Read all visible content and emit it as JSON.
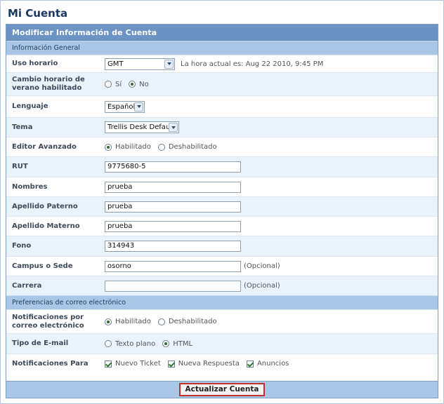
{
  "page": {
    "title": "Mi Cuenta"
  },
  "panel": {
    "title": "Modificar Información de Cuenta"
  },
  "sections": {
    "general": "Información General",
    "email": "Preferencias de correo electrónico"
  },
  "fields": {
    "timezone": {
      "label": "Uso horario",
      "value": "GMT",
      "hint": "La hora actual es: Aug 22 2010, 9:45 PM"
    },
    "dst": {
      "label": "Cambio horario de verano habilitado",
      "yes": "Sí",
      "no": "No",
      "selected": "no"
    },
    "language": {
      "label": "Lenguaje",
      "value": "Español"
    },
    "theme": {
      "label": "Tema",
      "value": "Trellis Desk Default"
    },
    "editor": {
      "label": "Editor Avanzado",
      "on": "Habilitado",
      "off": "Deshabilitado",
      "selected": "on"
    },
    "rut": {
      "label": "RUT",
      "value": "9775680-5"
    },
    "nombres": {
      "label": "Nombres",
      "value": "prueba"
    },
    "apellido_paterno": {
      "label": "Apellido Paterno",
      "value": "prueba"
    },
    "apellido_materno": {
      "label": "Apellido Materno",
      "value": "prueba"
    },
    "fono": {
      "label": "Fono",
      "value": "314943"
    },
    "campus": {
      "label": "Campus o Sede",
      "value": "osorno",
      "hint": "(Opcional)"
    },
    "carrera": {
      "label": "Carrera",
      "value": "",
      "hint": "(Opcional)"
    },
    "notifications": {
      "label": "Notificaciones por correo electrónico",
      "on": "Habilitado",
      "off": "Deshabilitado",
      "selected": "on"
    },
    "email_type": {
      "label": "Tipo de E-mail",
      "plain": "Texto plano",
      "html": "HTML",
      "selected": "html"
    },
    "notify_for": {
      "label": "Notificaciones Para",
      "new_ticket": "Nuevo Ticket",
      "new_reply": "Nueva Respuesta",
      "announcements": "Anuncios"
    }
  },
  "footer": {
    "submit_label": "Actualizar Cuenta"
  }
}
